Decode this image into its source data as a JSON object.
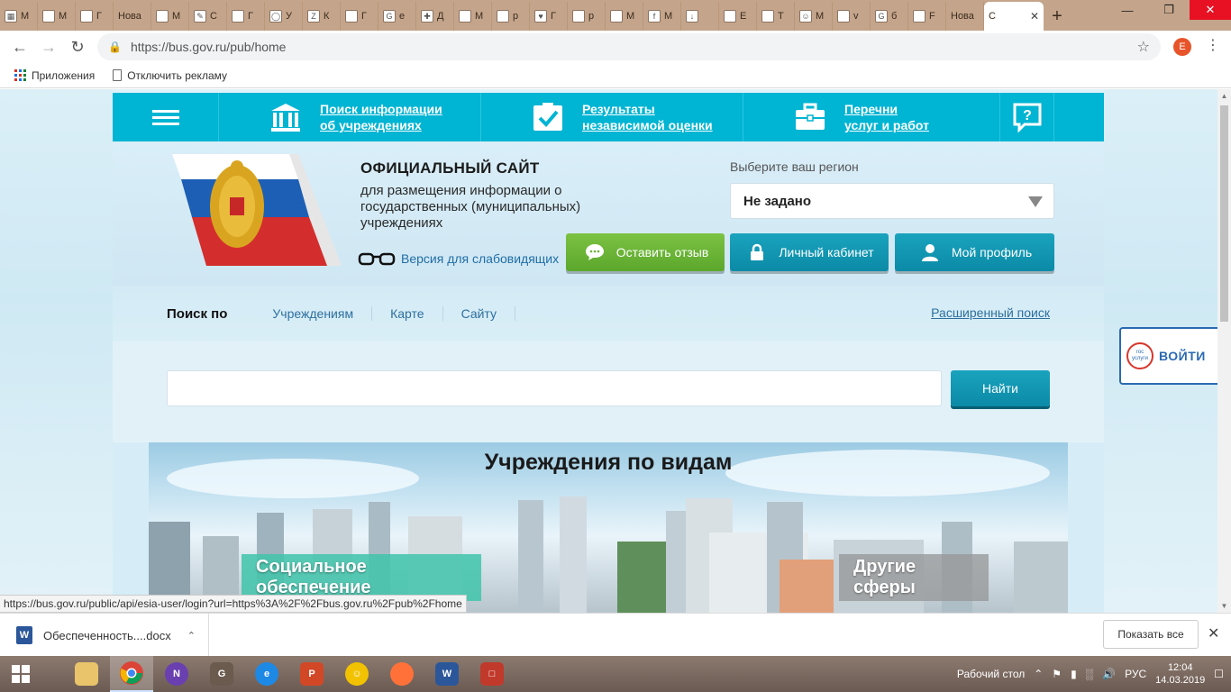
{
  "browser": {
    "tabs": [
      {
        "icon": "image-icon",
        "label": "М"
      },
      {
        "icon": "doc-icon",
        "label": "М"
      },
      {
        "icon": "doc-icon",
        "label": "Г"
      },
      {
        "icon": "none",
        "label": "Нова"
      },
      {
        "icon": "doc-icon",
        "label": "М"
      },
      {
        "icon": "pin-icon",
        "label": "С"
      },
      {
        "icon": "doc-icon",
        "label": "Г"
      },
      {
        "icon": "circle-icon",
        "label": "У"
      },
      {
        "icon": "z-icon",
        "label": "К"
      },
      {
        "icon": "doc-icon",
        "label": "Г"
      },
      {
        "icon": "google-icon",
        "label": "е"
      },
      {
        "icon": "plus-red-icon",
        "label": "Д"
      },
      {
        "icon": "doc-icon",
        "label": "М"
      },
      {
        "icon": "doc-icon",
        "label": "р"
      },
      {
        "icon": "heart-icon",
        "label": "Г"
      },
      {
        "icon": "doc-icon",
        "label": "р"
      },
      {
        "icon": "doc-icon",
        "label": "М"
      },
      {
        "icon": "facebook-icon",
        "label": "М"
      },
      {
        "icon": "download-icon",
        "label": ""
      },
      {
        "icon": "doc-icon",
        "label": "Е"
      },
      {
        "icon": "doc-icon",
        "label": "Т"
      },
      {
        "icon": "smile-icon",
        "label": "М"
      },
      {
        "icon": "doc-icon",
        "label": "v"
      },
      {
        "icon": "google-icon",
        "label": "б"
      },
      {
        "icon": "doc-icon",
        "label": "F"
      },
      {
        "icon": "none",
        "label": "Нова"
      }
    ],
    "active_tab": {
      "label": "С"
    },
    "url": "https://bus.gov.ru/pub/home",
    "profile_initial": "E",
    "bookmarks": [
      {
        "icon": "apps-icon",
        "label": "Приложения"
      },
      {
        "icon": "doc-icon",
        "label": "Отключить рекламу"
      }
    ],
    "status_url": "https://bus.gov.ru/public/api/esia-user/login?url=https%3A%2F%2Fbus.gov.ru%2Fpub%2Fhome"
  },
  "site": {
    "nav": [
      {
        "label": "Поиск информации\nоб учреждениях",
        "icon": "institution-icon"
      },
      {
        "label": "Результаты\nнезависимой оценки",
        "icon": "checkmark-icon"
      },
      {
        "label": "Перечни\nуслуг и работ",
        "icon": "briefcase-icon"
      }
    ],
    "title": "ОФИЦИАЛЬНЫЙ САЙТ",
    "subtitle": "для размещения информации о государственных (муниципальных) учреждениях",
    "low_vision": "Версия для слабовидящих",
    "region_label": "Выберите ваш регион",
    "region_value": "Не задано",
    "buttons": {
      "feedback": "Оставить отзыв",
      "cabinet": "Личный кабинет",
      "profile": "Мой профиль"
    },
    "search": {
      "lead": "Поиск по",
      "tabs": [
        "Учреждениям",
        "Карте",
        "Сайту"
      ],
      "advanced": "Расширенный поиск",
      "placeholder": "",
      "button": "Найти"
    },
    "types": {
      "heading": "Учреждения по видам",
      "categories": [
        "Социальное обеспечение",
        "Другие сферы"
      ]
    },
    "gos_login": {
      "logo_text": "гос услуги",
      "label": "ВОЙТИ"
    }
  },
  "downloads": {
    "file": "Обеспеченность....docx",
    "show_all": "Показать все"
  },
  "taskbar": {
    "desktop_label": "Рабочий стол",
    "lang": "РУС",
    "time": "12:04",
    "date": "14.03.2019"
  },
  "colors": {
    "accent": "#00b4d3",
    "feedback_green": "#6cb537",
    "button_blue": "#0b8aa6",
    "gos_blue": "#2a6ab2"
  }
}
